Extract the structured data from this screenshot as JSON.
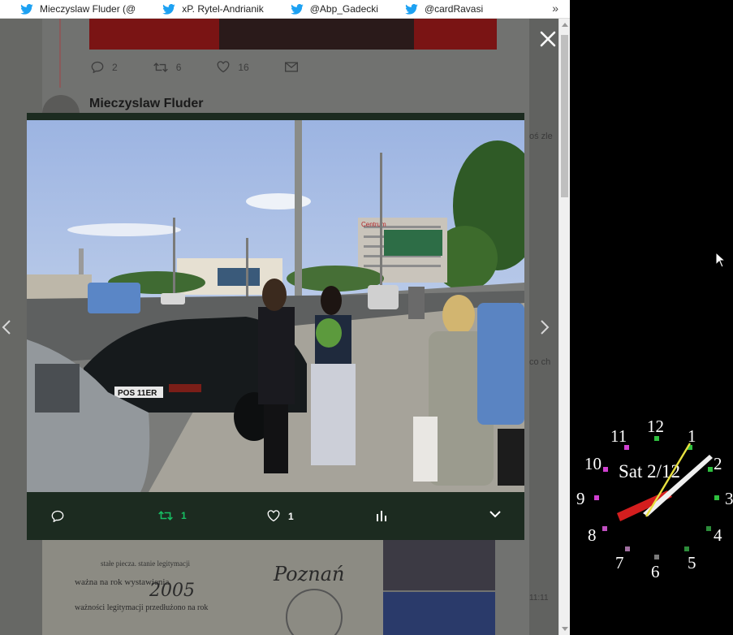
{
  "bookmarks": {
    "items": [
      {
        "label": "Mieczyslaw Fluder (@"
      },
      {
        "label": "xP. Rytel-Andrianik"
      },
      {
        "label": "@Abp_Gadecki"
      },
      {
        "label": "@cardRavasi"
      }
    ],
    "overflow_label": "»"
  },
  "background": {
    "tweet1_actions": {
      "reply_count": "2",
      "retweet_count": "6",
      "like_count": "16"
    },
    "tweet2": {
      "author": "Mieczyslaw Fluder",
      "ellipsis": "..."
    },
    "right_snippets": [
      "oś zle",
      "co ch"
    ],
    "doc": {
      "line1": "stałe piecza. stanie legitymacji",
      "line2": "ważna na rok wystawienia",
      "year": "2005",
      "line3": "ważności legitymacji przedłużono na rok",
      "signature": "Poznań"
    },
    "timestamp": "11:11"
  },
  "media": {
    "actions": {
      "retweet_count": "1",
      "like_count": "1"
    }
  },
  "photo": {
    "plate": "POS 11ER",
    "sign": "Centrum"
  },
  "clock": {
    "date_label": "Sat 2/12",
    "numbers": [
      "12",
      "1",
      "2",
      "3",
      "4",
      "5",
      "6",
      "7",
      "8",
      "9",
      "10",
      "11"
    ]
  },
  "colors": {
    "twitter_blue": "#1da1f2",
    "retweet_green": "#17bf63",
    "lightbox_bg": "#1c2b20"
  },
  "icons": [
    "twitter-bird-icon",
    "reply-icon",
    "retweet-icon",
    "like-icon",
    "mail-icon",
    "analytics-icon",
    "chevron-down-icon",
    "close-icon",
    "chevron-left-icon",
    "chevron-right-icon",
    "mouse-cursor-icon"
  ]
}
